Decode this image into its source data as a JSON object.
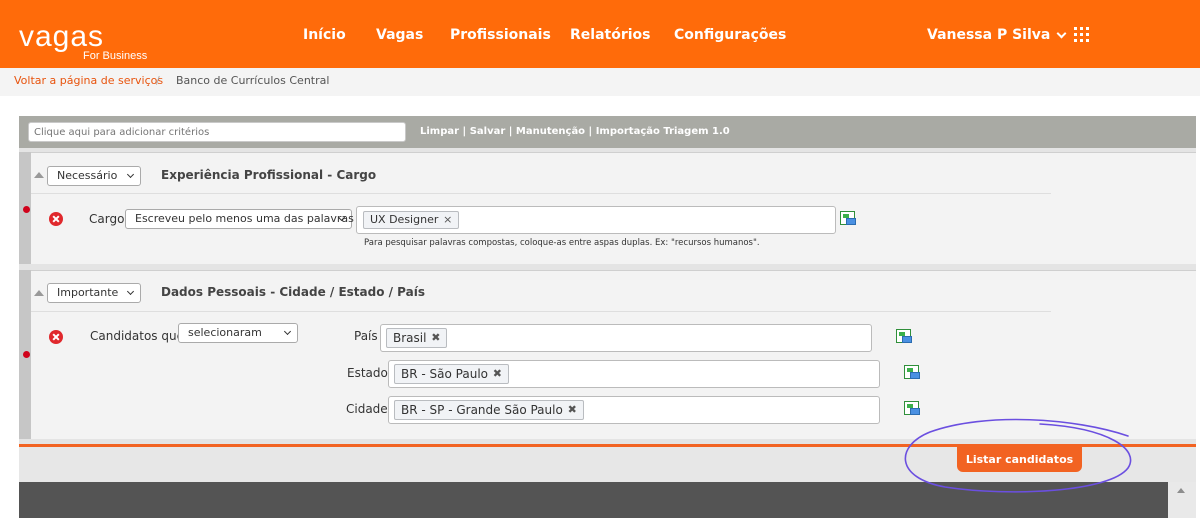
{
  "brand": {
    "logo": "vagas",
    "sub": "For Business"
  },
  "nav": [
    "Início",
    "Vagas",
    "Profissionais",
    "Relatórios",
    "Configurações"
  ],
  "user": {
    "name": "Vanessa P Silva"
  },
  "breadcrumb": {
    "back": "Voltar a página de serviços",
    "sep": "/",
    "current": "Banco de Currículos Central"
  },
  "toolbar": {
    "criteria_placeholder": "Clique aqui para adicionar critérios",
    "links": [
      "Limpar",
      "Salvar",
      "Manutenção",
      "Importação Triagem 1.0"
    ],
    "sep": "|"
  },
  "section1": {
    "priority": "Necessário",
    "title": "Experiência Profissional - Cargo",
    "field_label": "Cargo",
    "match_mode": "Escreveu pelo menos uma das palavras",
    "tags": [
      "UX Designer"
    ],
    "hint": "Para pesquisar palavras compostas, coloque-as entre aspas duplas. Ex: \"recursos humanos\"."
  },
  "section2": {
    "priority": "Importante",
    "title": "Dados Pessoais - Cidade / Estado / País",
    "field_label": "Candidatos que",
    "mode": "selecionaram",
    "rows": [
      {
        "label": "País",
        "tag": "Brasil"
      },
      {
        "label": "Estado",
        "tag": "BR - São Paulo"
      },
      {
        "label": "Cidade",
        "tag": "BR - SP - Grande São Paulo"
      }
    ]
  },
  "actions": {
    "list_button": "Listar candidatos"
  },
  "colors": {
    "brand_orange": "#ff6b0a",
    "button_orange": "#f26322",
    "annotation_purple": "#6b4fe0"
  },
  "icons": {
    "apps": "apps-grid-icon",
    "remove": "remove-circle-icon",
    "spreadsheet": "spreadsheet-icon"
  }
}
